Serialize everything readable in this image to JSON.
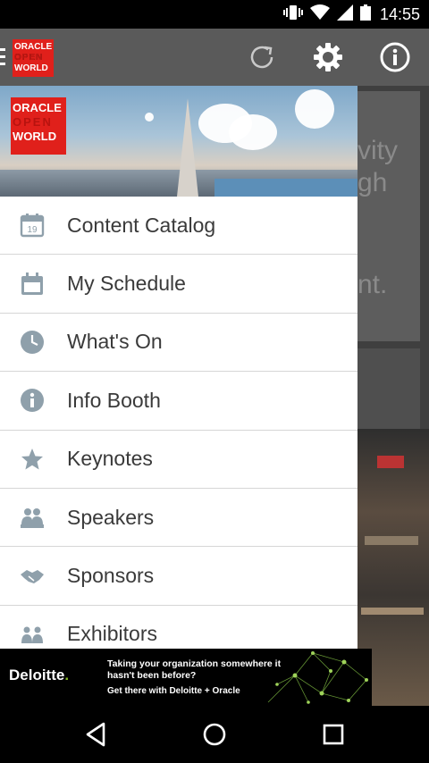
{
  "status_bar": {
    "time": "14:55",
    "icons": [
      "vibrate-icon",
      "wifi-icon",
      "signal-icon",
      "battery-icon"
    ]
  },
  "app_bar": {
    "logo_lines": [
      "ORACLE",
      "OPEN",
      "WORLD"
    ],
    "actions": [
      "refresh-icon",
      "settings-gear-icon",
      "info-icon"
    ]
  },
  "drawer": {
    "header_logo_lines": [
      "ORACLE",
      "OPEN",
      "WORLD"
    ],
    "menu": [
      {
        "label": "Content Catalog",
        "icon": "calendar-19-icon"
      },
      {
        "label": "My Schedule",
        "icon": "calendar-icon"
      },
      {
        "label": "What's On",
        "icon": "clock-icon"
      },
      {
        "label": "Info Booth",
        "icon": "info-icon"
      },
      {
        "label": "Keynotes",
        "icon": "star-icon"
      },
      {
        "label": "Speakers",
        "icon": "speakers-icon"
      },
      {
        "label": "Sponsors",
        "icon": "handshake-icon"
      },
      {
        "label": "Exhibitors",
        "icon": "exhibitors-icon"
      }
    ]
  },
  "background": {
    "text_lines": [
      "vity",
      "gh",
      "nt."
    ]
  },
  "ad": {
    "brand": "Deloitte",
    "brand_dot": ".",
    "headline": "Taking your organization somewhere it hasn't been before?",
    "subline": "Get there with Deloitte + Oracle"
  },
  "colors": {
    "app_bar": "#5a5a5a",
    "icon_gray": "#8fa0ab",
    "oracle_red": "#e0201b",
    "deloitte_green": "#86bc25"
  }
}
